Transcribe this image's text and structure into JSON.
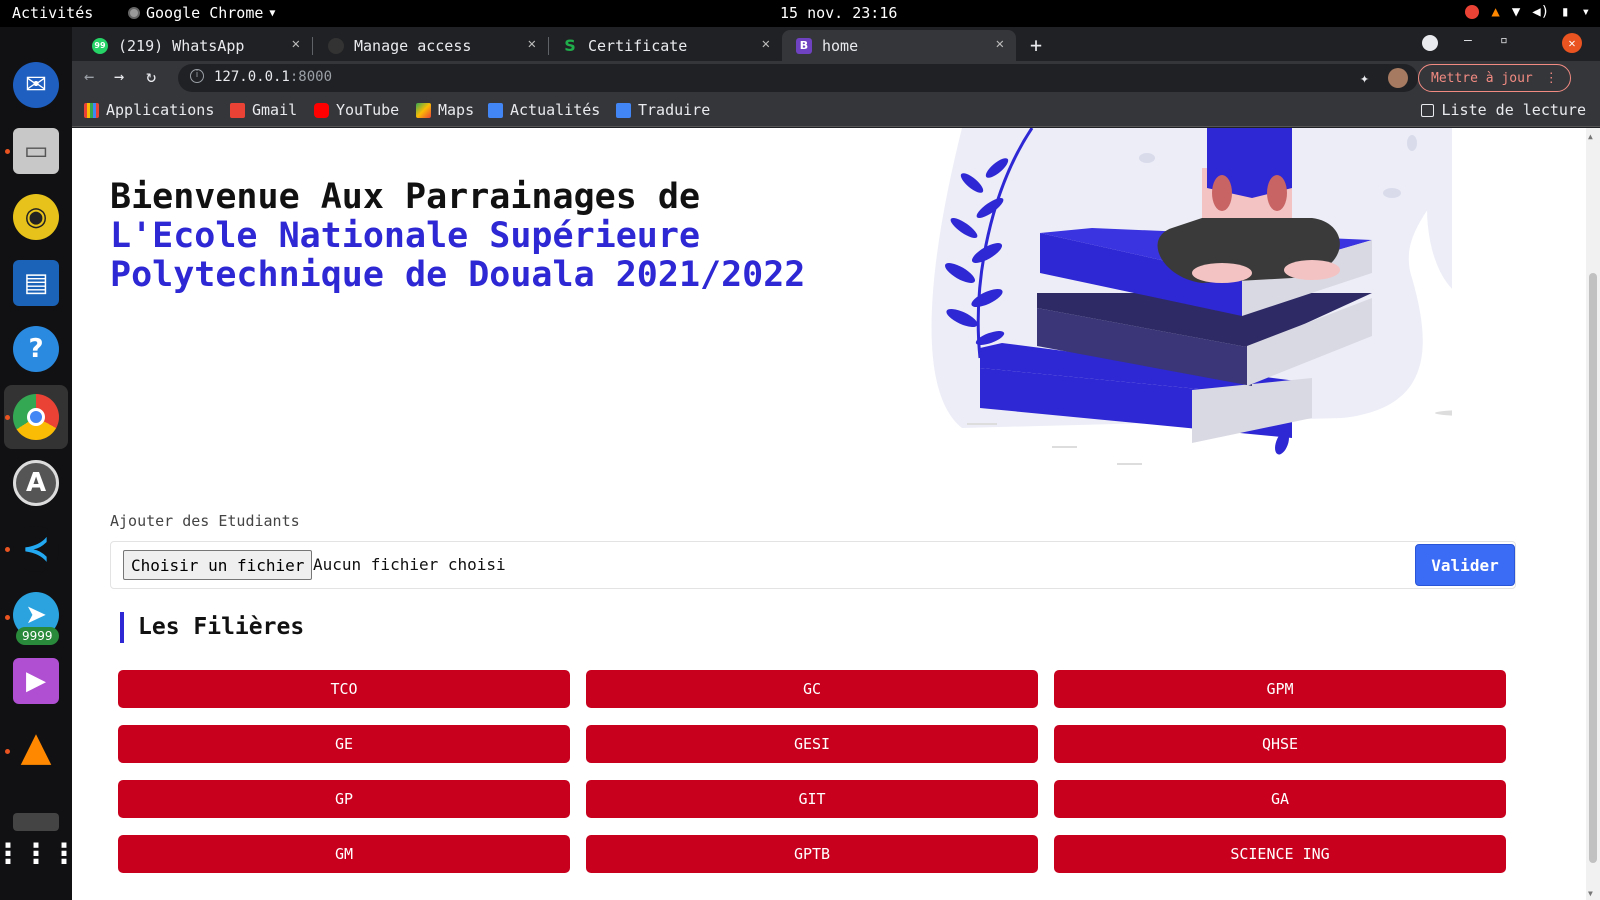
{
  "os": {
    "activities": "Activités",
    "app_menu": "Google Chrome",
    "clock": "15 nov.  23:16"
  },
  "dock": {
    "telegram_badge": "9999"
  },
  "browser": {
    "tabs": [
      {
        "title": "(219) WhatsApp",
        "favicon_color": "#25d366",
        "favicon": "99"
      },
      {
        "title": "Manage access",
        "favicon_color": "#333",
        "favicon": ""
      },
      {
        "title": "Certificate",
        "favicon_color": "#1fae4b",
        "favicon": "S"
      },
      {
        "title": "home",
        "favicon_color": "#6f42c1",
        "favicon": "B"
      }
    ],
    "url_host": "127.0.0.1",
    "url_port": ":8000",
    "update_button": "Mettre à jour",
    "bookmarks": [
      {
        "label": "Applications",
        "color": "#ea4335"
      },
      {
        "label": "Gmail",
        "color": "#ea4335"
      },
      {
        "label": "YouTube",
        "color": "#ff0000"
      },
      {
        "label": "Maps",
        "color": "#34a853"
      },
      {
        "label": "Actualités",
        "color": "#4285f4"
      },
      {
        "label": "Traduire",
        "color": "#4285f4"
      }
    ],
    "reading_list": "Liste de lecture"
  },
  "page": {
    "title_line1": "Bienvenue Aux Parrainages de",
    "title_line2": "L'Ecole Nationale Supérieure Polytechnique de Douala 2021/2022",
    "upload_label": "Ajouter des Etudiants",
    "file_button": "Choisir un fichier",
    "file_status": "Aucun fichier choisi",
    "submit_button": "Valider",
    "section_title": "Les Filières",
    "programs": [
      "TCO",
      "GC",
      "GPM",
      "GE",
      "GESI",
      "QHSE",
      "GP",
      "GIT",
      "GA",
      "GM",
      "GPTB",
      "SCIENCE ING"
    ],
    "accent_color": "#2e27d4",
    "program_color": "#c8001e"
  }
}
